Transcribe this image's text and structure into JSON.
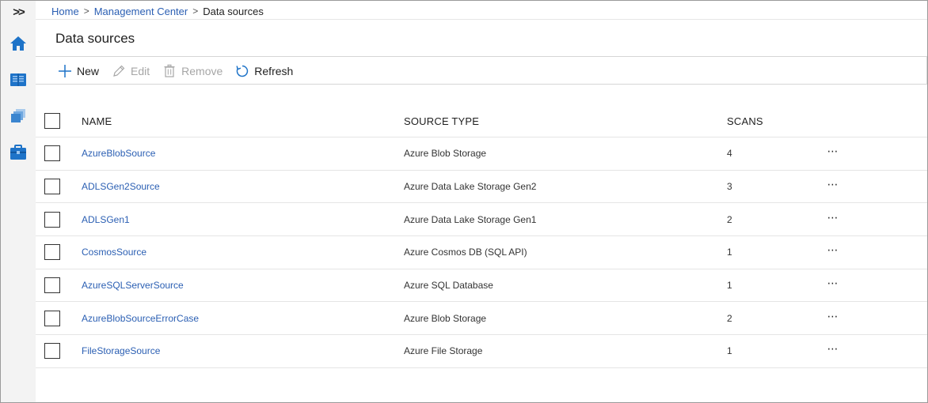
{
  "rail": {
    "expand_label": ">>",
    "items": [
      {
        "icon": "home-icon"
      },
      {
        "icon": "catalog-icon"
      },
      {
        "icon": "sources-icon"
      },
      {
        "icon": "management-icon"
      }
    ]
  },
  "breadcrumb": {
    "home": "Home",
    "sep1": ">",
    "management": "Management Center",
    "sep2": ">",
    "current": "Data sources"
  },
  "page": {
    "title": "Data sources"
  },
  "toolbar": {
    "new_label": "New",
    "edit_label": "Edit",
    "remove_label": "Remove",
    "refresh_label": "Refresh"
  },
  "table": {
    "columns": {
      "name": "NAME",
      "type": "SOURCE TYPE",
      "scans": "SCANS"
    },
    "more_label": "⋯",
    "rows": [
      {
        "name": "AzureBlobSource",
        "type": "Azure Blob Storage",
        "scans": "4"
      },
      {
        "name": "ADLSGen2Source",
        "type": "Azure Data Lake Storage Gen2",
        "scans": "3"
      },
      {
        "name": "ADLSGen1",
        "type": "Azure Data Lake Storage Gen1",
        "scans": "2"
      },
      {
        "name": "CosmosSource",
        "type": "Azure Cosmos DB (SQL API)",
        "scans": "1"
      },
      {
        "name": "AzureSQLServerSource",
        "type": "Azure SQL Database",
        "scans": "1"
      },
      {
        "name": "AzureBlobSourceErrorCase",
        "type": "Azure Blob Storage",
        "scans": "2"
      },
      {
        "name": "FileStorageSource",
        "type": "Azure File Storage",
        "scans": "1"
      }
    ]
  },
  "colors": {
    "link": "#2b5fb3",
    "icon_blue": "#1e73c8",
    "rail_bg": "#f3f3f3",
    "disabled": "#a6a6a6"
  }
}
